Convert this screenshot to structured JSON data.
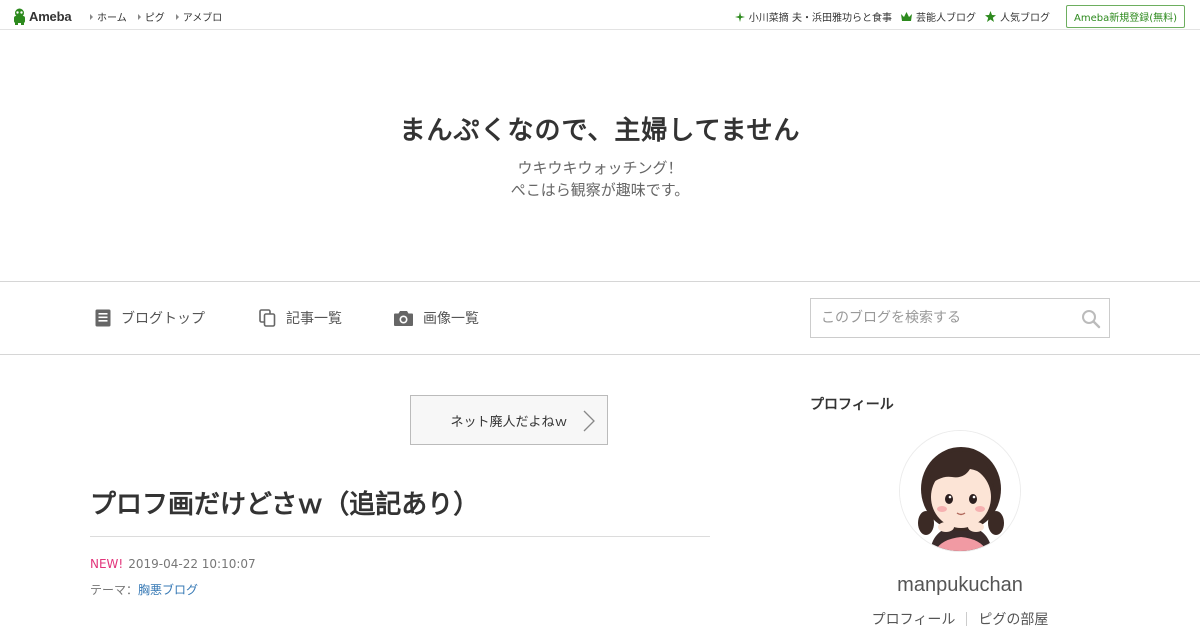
{
  "topbar": {
    "logo_text": "Ameba",
    "nav": [
      "ホーム",
      "ピグ",
      "アメブロ"
    ],
    "links": [
      {
        "label": "小川菜摘 夫・浜田雅功らと食事",
        "icon": "sparkle-icon"
      },
      {
        "label": "芸能人ブログ",
        "icon": "crown-icon"
      },
      {
        "label": "人気ブログ",
        "icon": "star-icon"
      }
    ],
    "signup_label": "Ameba新規登録(無料)",
    "accent": "#2d8a1e"
  },
  "header": {
    "title": "まんぷくなので、主婦してません",
    "description_line1": "ウキウキウォッチング！",
    "description_line2": "ぺこはら観察が趣味です。"
  },
  "navbar": {
    "items": [
      {
        "label": "ブログトップ",
        "icon": "document-icon"
      },
      {
        "label": "記事一覧",
        "icon": "copy-icon"
      },
      {
        "label": "画像一覧",
        "icon": "camera-icon"
      }
    ],
    "search_placeholder": "このブログを検索する"
  },
  "main": {
    "theme_button": "ネット廃人だよねｗ",
    "entry": {
      "title": "プロフ画だけどさｗ（追記あり）",
      "new_badge": "NEW!",
      "datetime": "2019-04-22 10:10:07",
      "theme_label": "テーマ：",
      "theme_link": "胸悪ブログ"
    }
  },
  "sidebar": {
    "heading": "プロフィール",
    "username": "manpukuchan",
    "links": [
      "プロフィール",
      "ピグの部屋"
    ]
  }
}
